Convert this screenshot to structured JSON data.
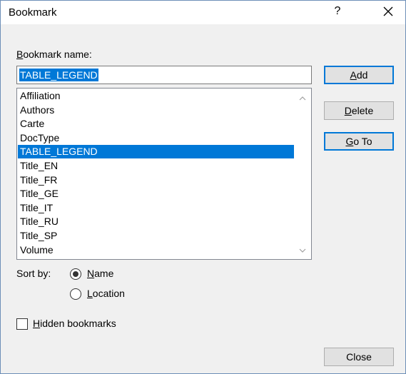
{
  "window": {
    "title": "Bookmark",
    "help_glyph": "?"
  },
  "bookmark_name": {
    "label_accel": "B",
    "label_rest": "ookmark name:",
    "value": "TABLE_LEGEND"
  },
  "list": {
    "items": [
      "Affiliation",
      "Authors",
      "Carte",
      "DocType",
      "TABLE_LEGEND",
      "Title_EN",
      "Title_FR",
      "Title_GE",
      "Title_IT",
      "Title_RU",
      "Title_SP",
      "Volume"
    ],
    "selected_index": 4
  },
  "buttons": {
    "add_accel": "A",
    "add_rest": "dd",
    "delete_accel": "D",
    "delete_rest": "elete",
    "goto_accel": "G",
    "goto_rest": "o To",
    "close": "Close"
  },
  "sort": {
    "label": "Sort by:",
    "name_accel": "N",
    "name_rest": "ame",
    "location_accel": "L",
    "location_rest": "ocation",
    "selected": "name"
  },
  "hidden": {
    "accel": "H",
    "rest": "idden bookmarks",
    "checked": false
  },
  "colors": {
    "selection": "#0078d7",
    "window_border": "#6d8fb8",
    "face": "#f0f0f0"
  }
}
